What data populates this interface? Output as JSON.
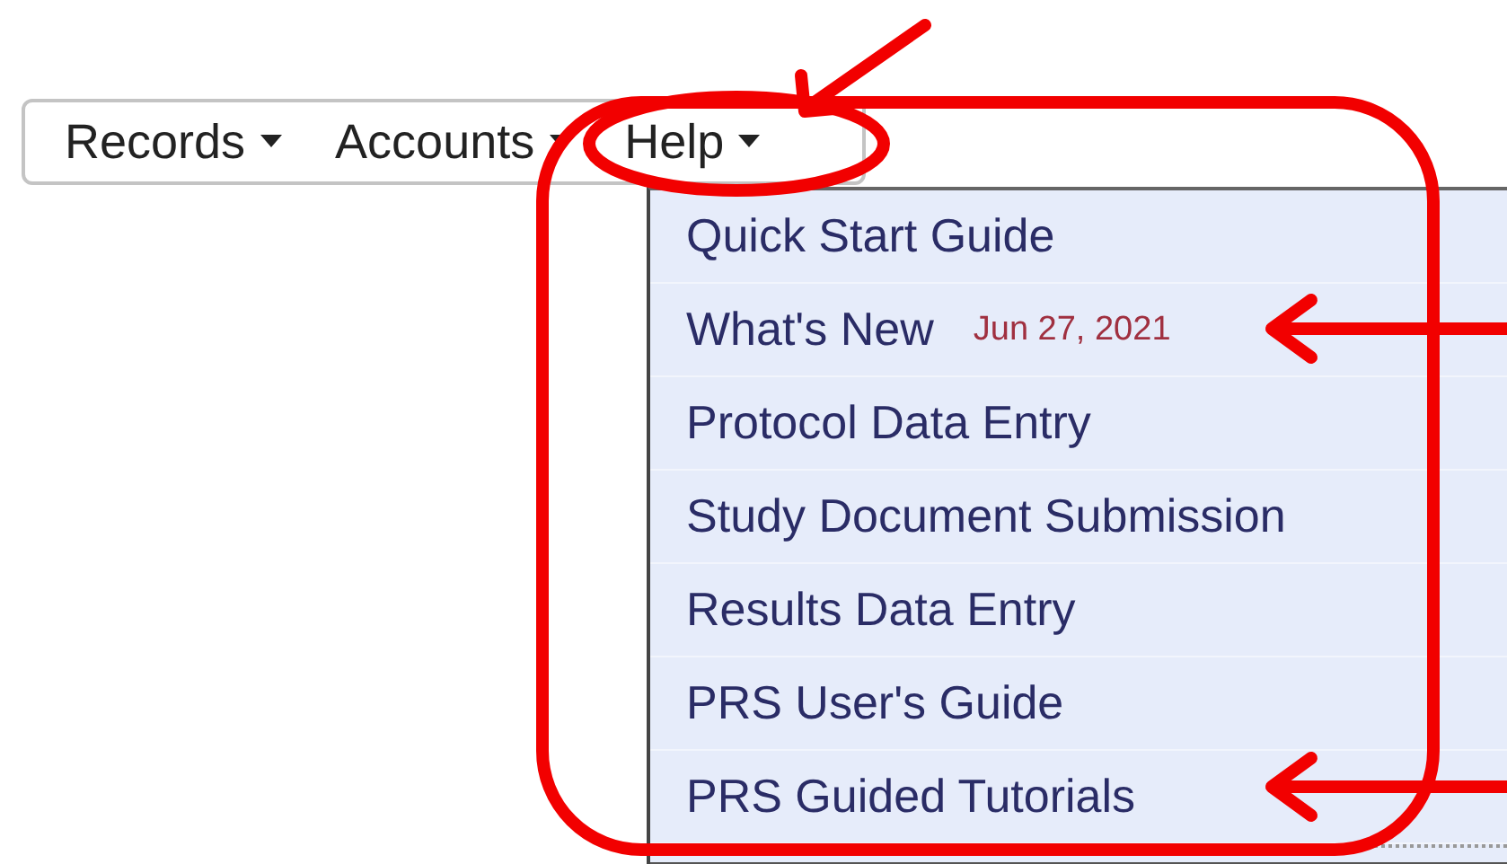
{
  "menubar": [
    {
      "label": "Records",
      "circled": false
    },
    {
      "label": "Accounts",
      "circled": false
    },
    {
      "label": "Help",
      "circled": true
    }
  ],
  "help_menu": {
    "framed": true,
    "items": [
      {
        "label": "Quick Start Guide",
        "pointed": false
      },
      {
        "label": "What's New",
        "date": "Jun 27, 2021",
        "pointed": true
      },
      {
        "label": "Protocol Data Entry",
        "pointed": false
      },
      {
        "label": "Study Document Submission",
        "pointed": false
      },
      {
        "label": "Results Data Entry",
        "pointed": false
      },
      {
        "label": "PRS User's Guide",
        "pointed": false
      },
      {
        "label": "PRS Guided Tutorials",
        "pointed": true
      }
    ]
  }
}
